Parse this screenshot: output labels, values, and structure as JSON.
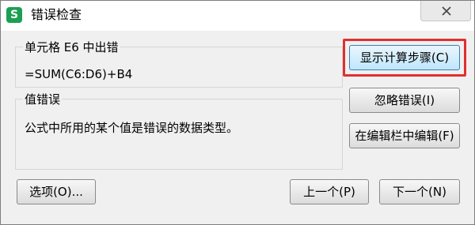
{
  "window": {
    "title": "错误检查",
    "app_icon_glyph": "S"
  },
  "cell_group": {
    "legend": "单元格 E6 中出错",
    "formula": "=SUM(C6:D6)+B4"
  },
  "error_group": {
    "legend": "值错误",
    "description": "公式中所用的某个值是错误的数据类型。"
  },
  "buttons": {
    "show_steps": "显示计算步骤(C)",
    "ignore_error": "忽略错误(I)",
    "edit_in_formula_bar": "在编辑栏中编辑(F)",
    "options": "选项(O)...",
    "previous": "上一个(P)",
    "next": "下一个(N)"
  },
  "colors": {
    "app_icon": "#1ba052",
    "highlight": "#e03030"
  }
}
